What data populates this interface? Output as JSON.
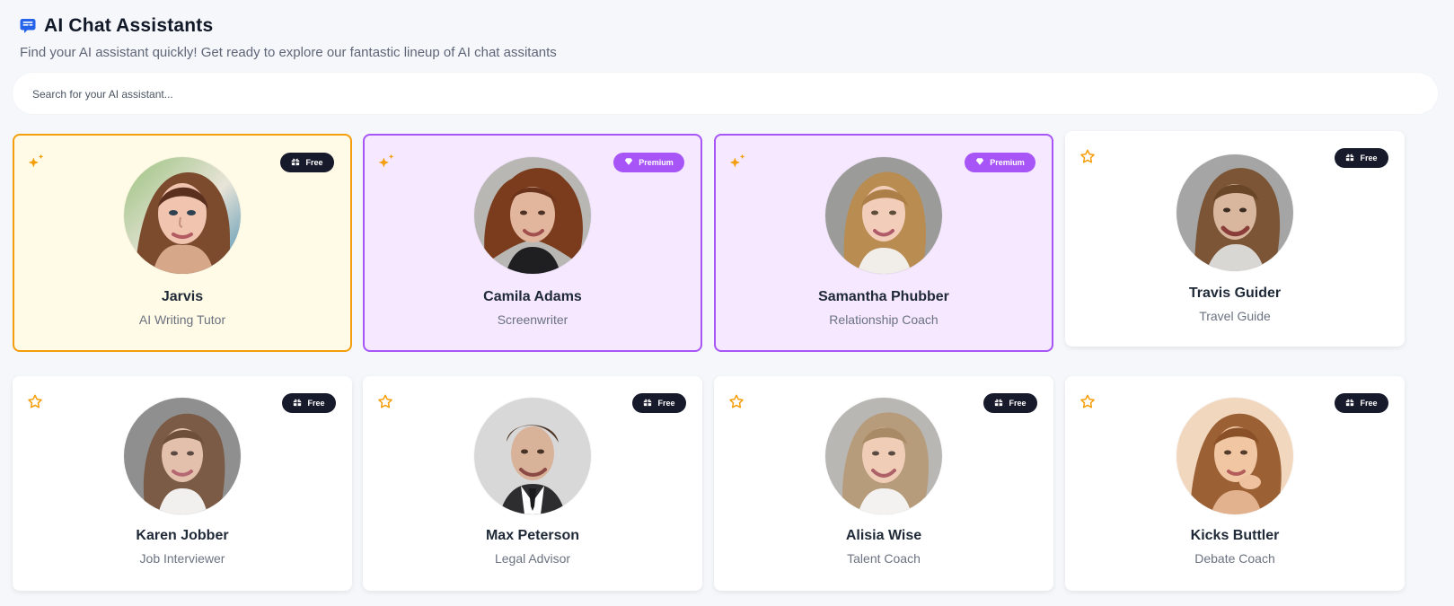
{
  "header": {
    "title": "AI Chat Assistants",
    "subtitle": "Find your AI assistant quickly! Get ready to explore our fantastic lineup of AI chat assitants"
  },
  "search": {
    "placeholder": "Search for your AI assistant...",
    "value": ""
  },
  "colors": {
    "background": "#f5f7fb",
    "free_badge": "#171a2b",
    "premium_badge": "#a855f7",
    "selected_free_border": "#f59e0b",
    "selected_premium_border": "#a855f7",
    "selected_free_bg": "#fffbe6",
    "selected_premium_bg": "#f5e8ff",
    "star": "#f59e0b"
  },
  "assistants": [
    {
      "name": "Jarvis",
      "role": "AI Writing Tutor",
      "badge": "Free",
      "badge_type": "free",
      "featured_icon": "sparkle-star-icon"
    },
    {
      "name": "Camila Adams",
      "role": "Screenwriter",
      "badge": "Premium",
      "badge_type": "premium",
      "featured_icon": "sparkle-star-icon"
    },
    {
      "name": "Samantha Phubber",
      "role": "Relationship Coach",
      "badge": "Premium",
      "badge_type": "premium",
      "featured_icon": "sparkle-star-icon"
    },
    {
      "name": "Travis Guider",
      "role": "Travel Guide",
      "badge": "Free",
      "badge_type": "free",
      "featured_icon": "star-outline-icon"
    },
    {
      "name": "Karen Jobber",
      "role": "Job Interviewer",
      "badge": "Free",
      "badge_type": "free",
      "featured_icon": "star-outline-icon"
    },
    {
      "name": "Max Peterson",
      "role": "Legal Advisor",
      "badge": "Free",
      "badge_type": "free",
      "featured_icon": "star-outline-icon"
    },
    {
      "name": "Alisia Wise",
      "role": "Talent Coach",
      "badge": "Free",
      "badge_type": "free",
      "featured_icon": "star-outline-icon"
    },
    {
      "name": "Kicks Buttler",
      "role": "Debate Coach",
      "badge": "Free",
      "badge_type": "free",
      "featured_icon": "star-outline-icon"
    }
  ]
}
